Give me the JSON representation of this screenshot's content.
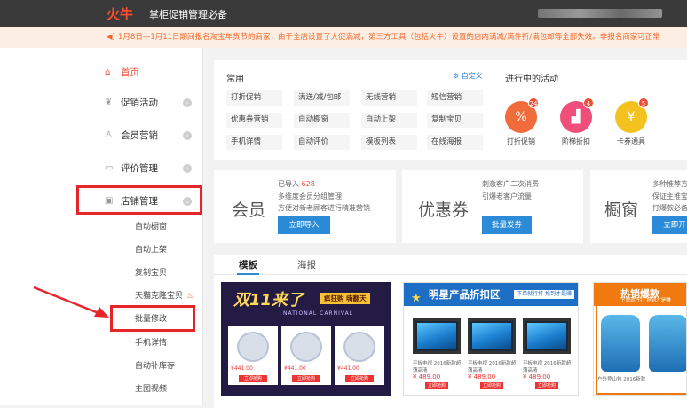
{
  "header": {
    "logo": "火牛",
    "app_title": "掌柜促销管理必备"
  },
  "notice": {
    "icon": "speaker-icon",
    "text": "1月8日—1月11日期间报名淘宝年货节的商家，由于全店设置了大促满减，第三方工具（包括火牛）设置的店内满减/满件折/满包邮等全部失效。非报名商家可正常"
  },
  "sidebar": {
    "items": [
      {
        "label": "首页",
        "icon": "home-icon"
      },
      {
        "label": "促销活动",
        "icon": "leaf-icon"
      },
      {
        "label": "会员营销",
        "icon": "user-icon"
      },
      {
        "label": "评价管理",
        "icon": "chat-icon"
      },
      {
        "label": "店铺管理",
        "icon": "store-icon"
      }
    ],
    "sub_items": [
      "自动橱窗",
      "自动上架",
      "复制宝贝",
      "天猫克隆宝贝",
      "批量修改",
      "手机详情",
      "自动补库存",
      "主图视频"
    ]
  },
  "common": {
    "title": "常用",
    "customize": "自定义",
    "chips": [
      "打折促销",
      "满送/减/包邮",
      "无线营销",
      "短信营销",
      "优惠券营销",
      "自动橱窗",
      "自动上架",
      "复制宝贝",
      "手机详情",
      "自动评价",
      "模板列表",
      "在线海报"
    ]
  },
  "running": {
    "title": "进行中的活动",
    "items": [
      {
        "label": "打折促销",
        "count": "24",
        "color": "#f26b3a",
        "icon": "percent-icon"
      },
      {
        "label": "阶梯折扣",
        "count": "4",
        "color": "#ef4f7a",
        "icon": "stairs-icon"
      },
      {
        "label": "卡券通具",
        "count": "5",
        "color": "#f4c21f",
        "icon": "coupon-icon"
      }
    ]
  },
  "promos": {
    "member": {
      "title": "会员",
      "imported_label": "已导入",
      "imported_count": "628",
      "line2": "多维度会员分组管理",
      "line3": "方便对新老顾客进行精准营销",
      "button": "立即导入"
    },
    "coupon": {
      "title": "优惠券",
      "line1": "刺激客户二次消费",
      "line2": "引爆老客户流量",
      "button": "批量发券"
    },
    "window": {
      "title": "橱窗",
      "line1": "多种推荐方",
      "line2": "保证主推宝",
      "line3": "打爆款必备",
      "button": "立即开"
    }
  },
  "tabs": {
    "items": [
      "模板",
      "海报"
    ],
    "active": "模板"
  },
  "templates": {
    "t1": {
      "headline": "双11来了",
      "badge": "疯狂购 嗨翻天",
      "subline": "NATIONAL CARNIVAL",
      "price": "¥441.00",
      "product": "柔软卡通毛绒玩具",
      "buy": "立即抢购"
    },
    "t2": {
      "headline": "明星产品折扣区",
      "tip": "下单就行打 抢到才是赚",
      "price": "¥ 489.00",
      "product": "平板电视 2016新款超薄高清",
      "buy": "立即抢购"
    },
    "t3": {
      "headline": "热销爆款",
      "tip": "下单就行打 抢到才是赚",
      "product": "户外登山包 2016新款"
    }
  }
}
